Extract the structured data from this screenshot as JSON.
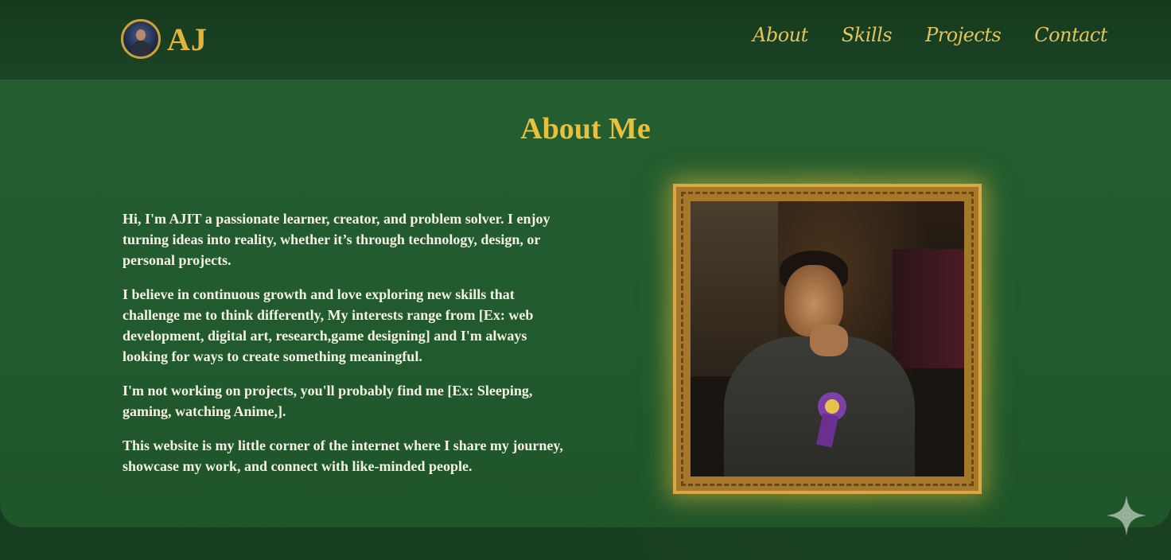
{
  "logo": {
    "icon": "avatar-logo",
    "text": "AJ"
  },
  "nav": {
    "links": [
      {
        "label": "About"
      },
      {
        "label": "Skills"
      },
      {
        "label": "Projects"
      },
      {
        "label": "Contact"
      }
    ]
  },
  "about": {
    "title": "About Me",
    "paragraphs": [
      "Hi, I'm AJIT a passionate learner, creator, and problem solver. I enjoy turning ideas into reality, whether it’s through technology, design, or personal projects.",
      "I believe in continuous growth and love exploring new skills that challenge me to think differently, My interests range from [Ex: web development, digital art, research,game designing] and I'm always looking for ways to create something meaningful.",
      "I'm not working on projects, you'll probably find me [Ex: Sleeping, gaming, watching Anime,].",
      "This website is my little corner of the internet where I share my journey, showcase my work, and connect with like-minded people."
    ],
    "portrait_icon": "portrait-photo"
  },
  "decor": {
    "sparkle_icon": "sparkle-icon"
  },
  "colors": {
    "background": "#173d20",
    "panel": "#245e30",
    "accent_gold": "#e8c03e",
    "text_light": "#f5f1e4",
    "frame_gold": "#a8782a"
  }
}
